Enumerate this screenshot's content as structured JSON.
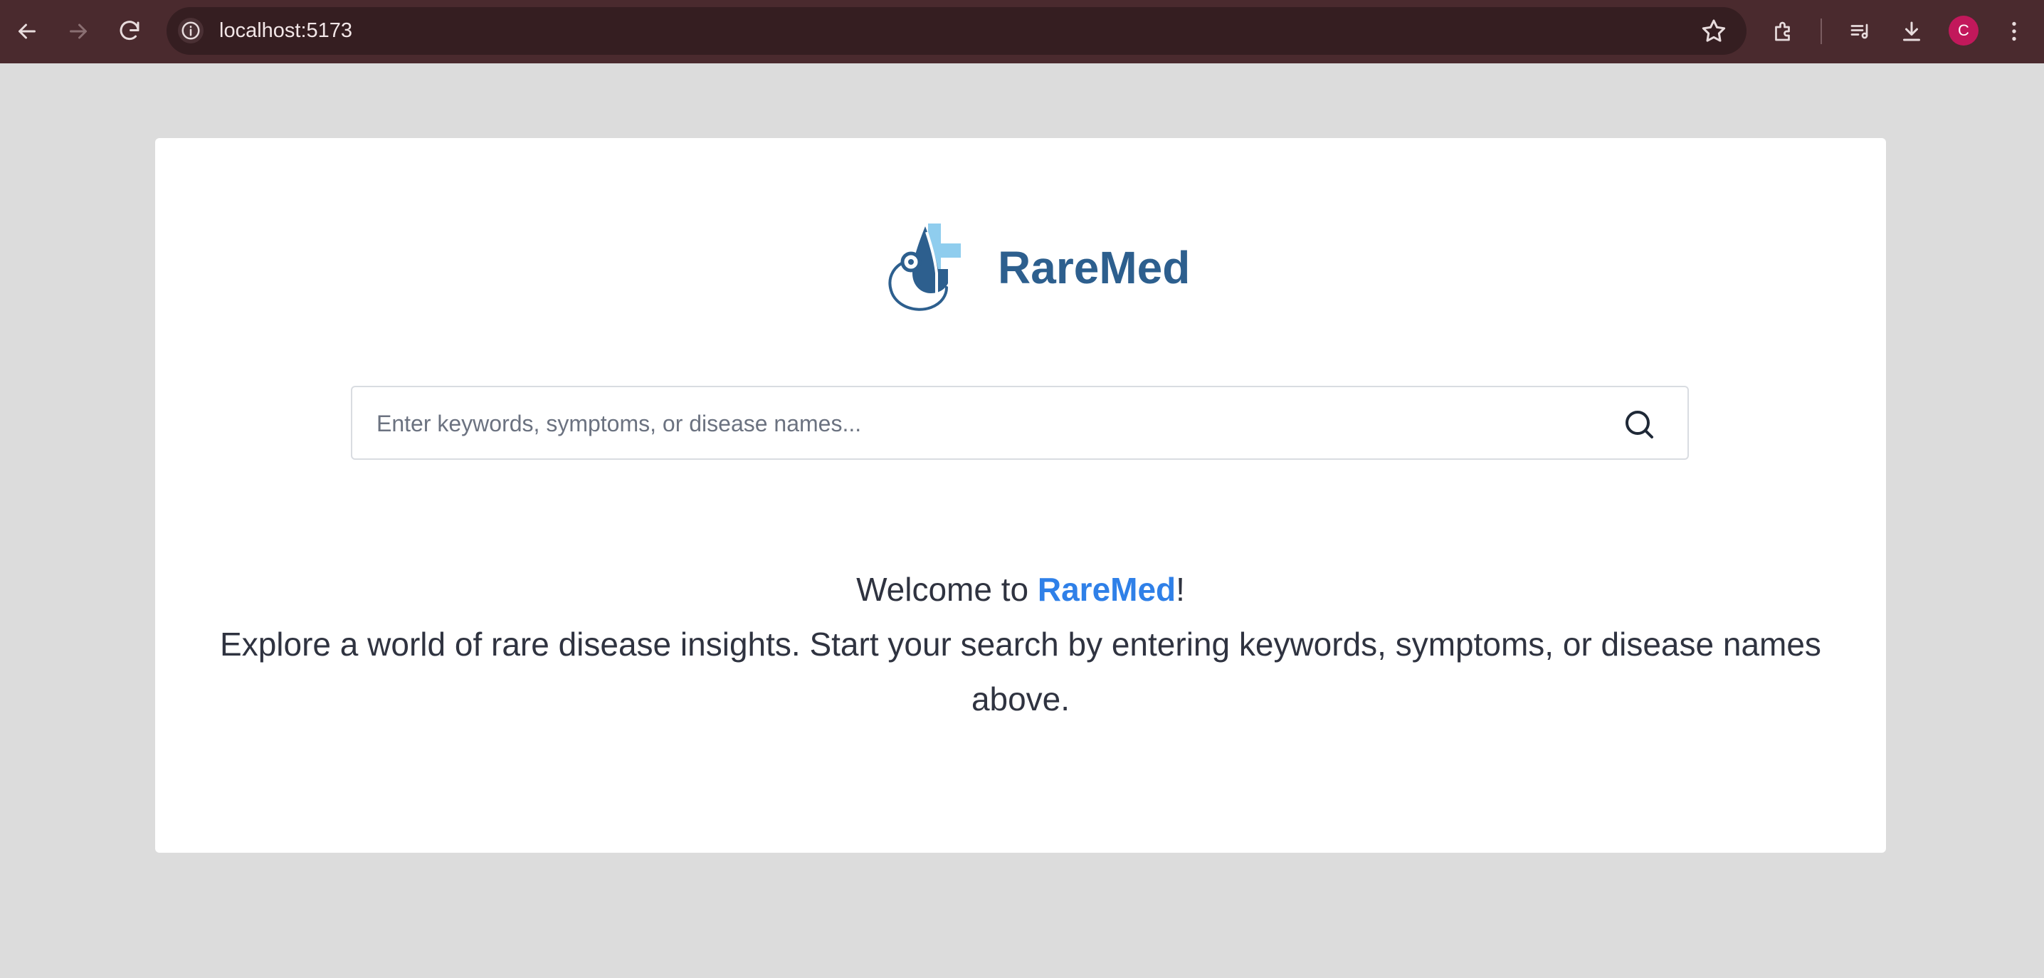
{
  "browser": {
    "url": "localhost:5173",
    "profile_initial": "C",
    "icons": [
      "back-icon",
      "forward-icon",
      "reload-icon",
      "info-icon",
      "star-icon",
      "extensions-icon",
      "media-icon",
      "download-icon",
      "menu-icon"
    ]
  },
  "app": {
    "brand": "RareMed",
    "search": {
      "placeholder": "Enter keywords, symptoms, or disease names..."
    },
    "welcome": {
      "prefix": "Welcome to ",
      "brand": "RareMed",
      "suffix": "!",
      "description": "Explore a world of rare disease insights. Start your search by entering keywords, symptoms, or disease names above."
    }
  },
  "colors": {
    "brand": "#2d5f8e",
    "highlight": "#2f80e8",
    "logo_light": "#8fcdee",
    "page_bg": "#dcdcdc",
    "toolbar_bg": "#4a2a2e"
  }
}
